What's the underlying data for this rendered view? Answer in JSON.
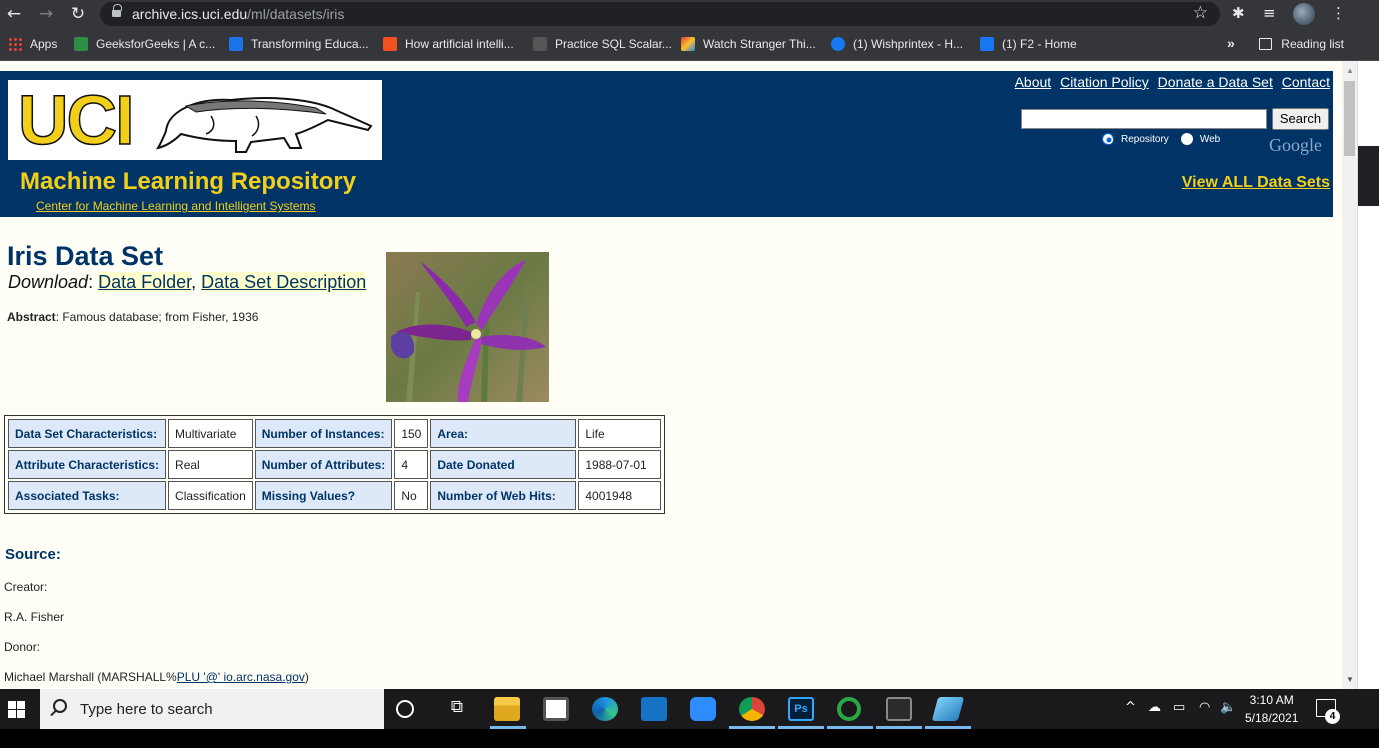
{
  "browser": {
    "url_host": "archive.ics.uci.edu",
    "url_path": "/ml/datasets/iris",
    "bookmarks": [
      {
        "label": "Apps",
        "color": "#ea4335"
      },
      {
        "label": "GeeksforGeeks | A c...",
        "color": "#2f8d46"
      },
      {
        "label": "Transforming Educa...",
        "color": "#1a73e8"
      },
      {
        "label": "How artificial intelli...",
        "color": "#f4511e"
      },
      {
        "label": "Practice SQL Scalar...",
        "color": "#555555"
      },
      {
        "label": "Watch Stranger Thi...",
        "color": "#e53935"
      },
      {
        "label": "(1) Wishprintex - H...",
        "color": "#1877f2"
      },
      {
        "label": "(1) F2 - Home",
        "color": "#1877f2"
      }
    ],
    "reading_list": "Reading list"
  },
  "header": {
    "logo_text": "UCI",
    "title": "Machine Learning Repository",
    "subtitle_link": "Center for Machine Learning and Intelligent Systems",
    "top_links": [
      "About",
      "Citation Policy",
      "Donate a Data Set",
      "Contact"
    ],
    "search_button": "Search",
    "radio_repository": "Repository",
    "radio_web": "Web",
    "google": "Google",
    "view_all": "View ALL Data Sets",
    "colors": {
      "background": "#003366",
      "accent": "#f2cf1b"
    }
  },
  "dataset": {
    "title": "Iris Data Set",
    "download_label": "Download",
    "download_links": [
      "Data Folder",
      "Data Set Description"
    ],
    "abstract_label": "Abstract",
    "abstract_text": ": Famous database; from Fisher, 1936",
    "table": [
      [
        {
          "l": "Data Set Characteristics:",
          "v": "Multivariate"
        },
        {
          "l": "Number of Instances:",
          "v": "150"
        },
        {
          "l": "Area:",
          "v": "Life"
        }
      ],
      [
        {
          "l": "Attribute Characteristics:",
          "v": "Real"
        },
        {
          "l": "Number of Attributes:",
          "v": "4"
        },
        {
          "l": "Date Donated",
          "v": "1988-07-01"
        }
      ],
      [
        {
          "l": "Associated Tasks:",
          "v": "Classification"
        },
        {
          "l": "Missing Values?",
          "v": "No"
        },
        {
          "l": "Number of Web Hits:",
          "v": "4001948"
        }
      ]
    ],
    "source_heading": "Source:",
    "creator_label": "Creator:",
    "creator": "R.A. Fisher",
    "donor_label": "Donor:",
    "donor_prefix": "Michael Marshall (MARSHALL%",
    "donor_link": "PLU '@' io.arc.nasa.gov",
    "donor_suffix": ")"
  },
  "taskbar": {
    "search_placeholder": "Type here to search",
    "time": "3:10 AM",
    "date": "5/18/2021",
    "notifications": "4"
  }
}
